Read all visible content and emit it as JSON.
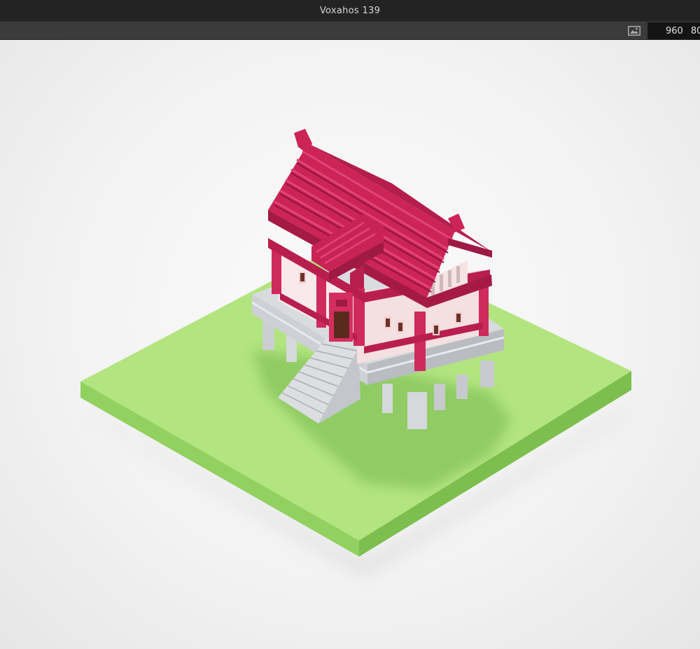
{
  "window": {
    "title": "Voxahos  139"
  },
  "toolbar": {
    "image_button_icon": "image-icon",
    "resolution": {
      "width": "960",
      "height": "80"
    }
  },
  "scene": {
    "colors": {
      "roof": "#cc2457",
      "roof_dark": "#8f163c",
      "roof_light": "#e03b6c",
      "wall": "#f7e6e7",
      "stone": "#d6d8dc",
      "stone_dark": "#b6b9be",
      "grass_top": "#a9e078",
      "grass_left": "#8fd05e",
      "grass_right": "#79bd4b"
    }
  }
}
